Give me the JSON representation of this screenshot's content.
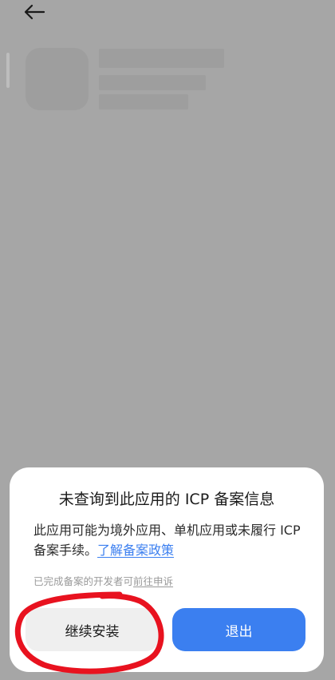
{
  "header": {
    "back_icon": "arrow-left-icon"
  },
  "dialog": {
    "title": "未查询到此应用的 ICP 备案信息",
    "body_text": "此应用可能为境外应用、单机应用或未履行 ICP 备案手续。",
    "body_link": "了解备案政策",
    "note_text": "已完成备案的开发者可",
    "note_link": "前往申诉",
    "continue_label": "继续安装",
    "exit_label": "退出"
  },
  "colors": {
    "accent": "#3b7ff0",
    "annotation": "#e8121f",
    "overlay": "#a6a6a6"
  }
}
